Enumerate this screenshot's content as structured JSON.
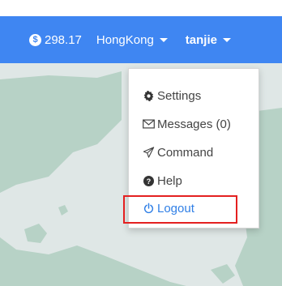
{
  "navbar": {
    "balance": "298.17",
    "region": "HongKong",
    "username": "tanjie"
  },
  "menu": {
    "items": [
      {
        "label": "Settings",
        "icon": "gear-icon"
      },
      {
        "label": "Messages (0)",
        "icon": "envelope-icon"
      },
      {
        "label": "Command",
        "icon": "paper-plane-icon"
      },
      {
        "label": "Help",
        "icon": "question-circle-icon"
      },
      {
        "label": "Logout",
        "icon": "power-icon"
      }
    ]
  },
  "colors": {
    "navbar": "#3f86f2",
    "link": "#2f7fe6",
    "highlight": "#e42020",
    "water": "#dfe7e6",
    "land": "#b7d2c6"
  }
}
